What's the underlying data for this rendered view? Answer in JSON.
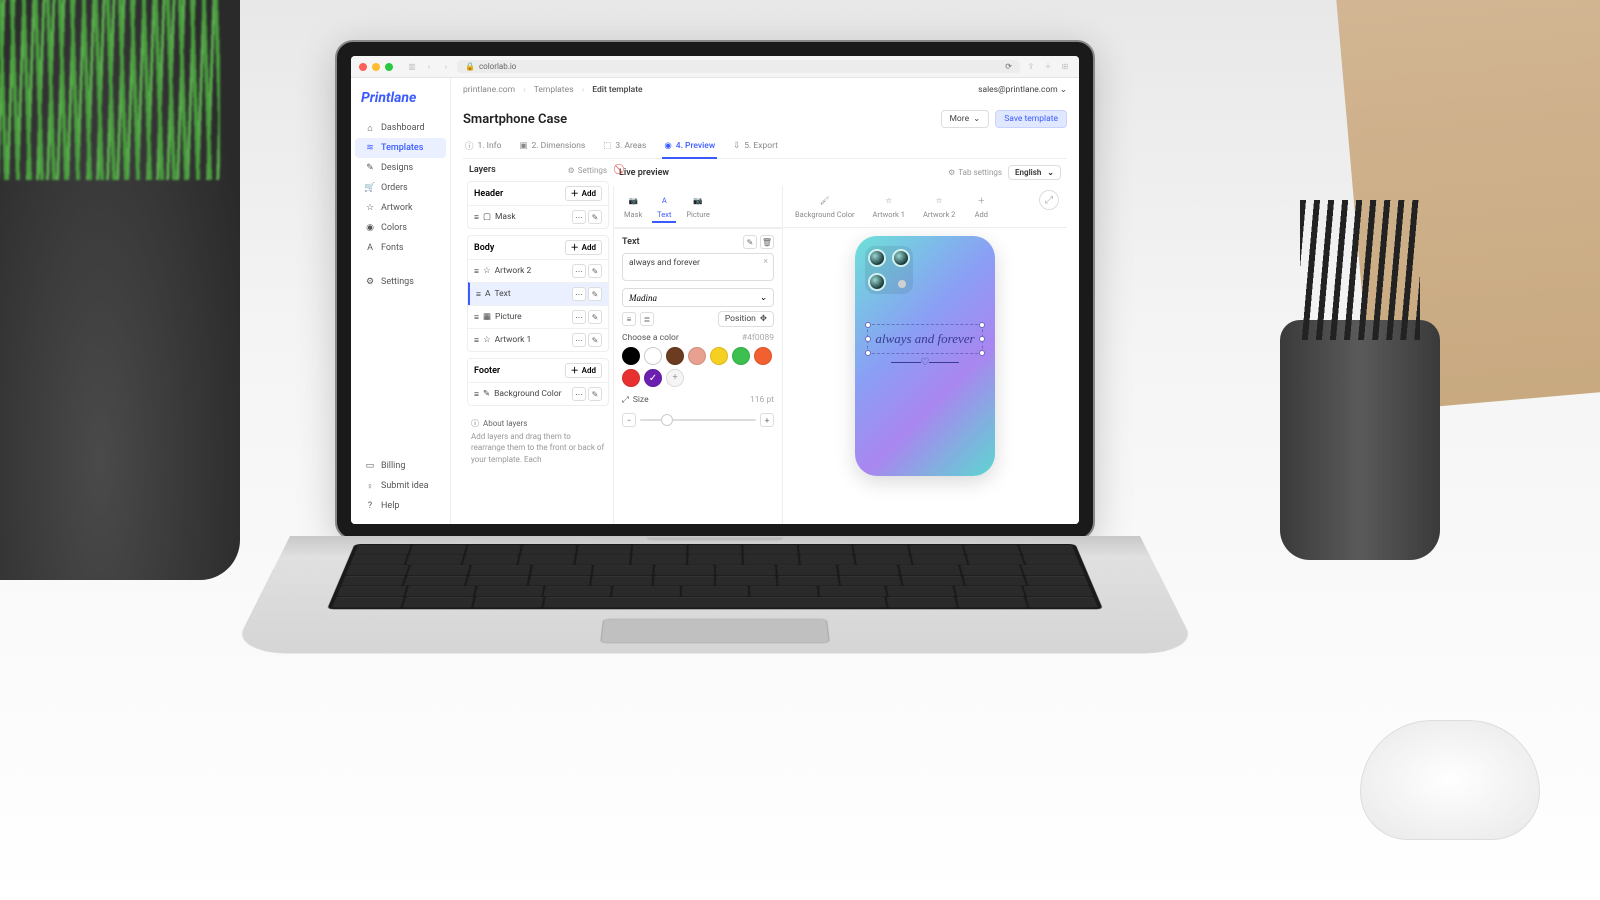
{
  "browser": {
    "url": "colorlab.io"
  },
  "brand": "Printlane",
  "breadcrumb": {
    "root": "printlane.com",
    "templates": "Templates",
    "current": "Edit template"
  },
  "user_email": "sales@printlane.com",
  "page_title": "Smartphone Case",
  "buttons": {
    "more": "More",
    "save": "Save template",
    "add": "Add",
    "position": "Position"
  },
  "sidebar": {
    "items": [
      {
        "label": "Dashboard"
      },
      {
        "label": "Templates"
      },
      {
        "label": "Designs"
      },
      {
        "label": "Orders"
      },
      {
        "label": "Artwork"
      },
      {
        "label": "Colors"
      },
      {
        "label": "Fonts"
      }
    ],
    "footer": [
      {
        "label": "Settings"
      },
      {
        "label": "Billing"
      },
      {
        "label": "Submit idea"
      },
      {
        "label": "Help"
      }
    ]
  },
  "tabs": [
    {
      "label": "1. Info"
    },
    {
      "label": "2. Dimensions"
    },
    {
      "label": "3. Areas"
    },
    {
      "label": "4. Preview"
    },
    {
      "label": "5. Export"
    }
  ],
  "layers": {
    "title": "Layers",
    "settings": "Settings",
    "groups": {
      "header": {
        "title": "Header",
        "items": [
          {
            "label": "Mask"
          }
        ]
      },
      "body": {
        "title": "Body",
        "items": [
          {
            "label": "Artwork 2"
          },
          {
            "label": "Text"
          },
          {
            "label": "Picture"
          },
          {
            "label": "Artwork 1"
          }
        ]
      },
      "footer": {
        "title": "Footer",
        "items": [
          {
            "label": "Background Color"
          }
        ]
      }
    },
    "about_title": "About layers",
    "about_text": "Add layers and drag them to rearrange them to the front or back of your template. Each"
  },
  "live": {
    "title": "Live preview",
    "tab_settings": "Tab settings",
    "language": "English",
    "tools": [
      {
        "label": "Mask"
      },
      {
        "label": "Text"
      },
      {
        "label": "Picture"
      },
      {
        "label": "Background Color"
      },
      {
        "label": "Artwork 1"
      },
      {
        "label": "Artwork 2"
      },
      {
        "label": "Add"
      }
    ]
  },
  "text_panel": {
    "label": "Text",
    "value": "always and forever",
    "font": "Madina",
    "color_label": "Choose a color",
    "color_hex": "#4f0089",
    "size_label": "Size",
    "size_value": "116 pt",
    "swatches": [
      "#000000",
      "#ffffff",
      "#6b3c1f",
      "#e8a090",
      "#f5d020",
      "#3cc050",
      "#f06030",
      "#e83030",
      "#6b20b0"
    ]
  },
  "phone_text": "always and forever"
}
